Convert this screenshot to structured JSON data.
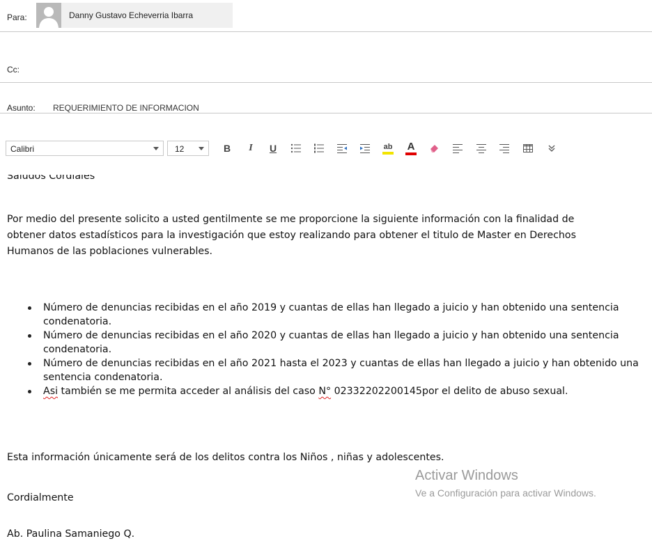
{
  "header": {
    "to_label": "Para:",
    "to_recipient": "Danny Gustavo Echeverria Ibarra",
    "cc_label": "Cc:",
    "subject_label": "Asunto:",
    "subject_value": "REQUERIMIENTO DE INFORMACION"
  },
  "toolbar": {
    "font_value": "Calibri",
    "size_value": "12",
    "bold": "B",
    "italic": "I",
    "underline": "U",
    "font_color_letter": "A",
    "highlight_label": "ab",
    "font_color": "#e00000",
    "highlight_color": "#f2e400"
  },
  "body": {
    "greeting": "Saludos Cordiales",
    "para1_line1": "Por medio del presente solicito a usted gentilmente se me proporcione la siguiente información con la finalidad de",
    "para1_line2": "obtener datos estadísticos para la investigación que estoy realizando para obtener el titulo de Master en Derechos",
    "para1_line3": "Humanos de las poblaciones vulnerables.",
    "bullet1": "Número de denuncias recibidas en el año 2019 y cuantas de ellas han llegado a juicio y han obtenido una sentencia condenatoria.",
    "bullet2": "Número de denuncias recibidas en el año 2020 y cuantas de ellas han llegado a juicio y han obtenido una sentencia condenatoria.",
    "bullet3": "Número de denuncias recibidas en el año 2021 hasta el 2023 y cuantas de ellas han llegado a juicio y han obtenido una sentencia condenatoria.",
    "bullet4_word1": "Asi",
    "bullet4_mid": " también se me permita acceder al análisis del caso ",
    "bullet4_word2": "N°",
    "bullet4_end": " 02332202200145por el delito de abuso sexual.",
    "para2": "Esta información únicamente será de los delitos contra los Niños , niñas y adolescentes.",
    "closing": "Cordialmente",
    "signature": "Ab. Paulina Samaniego Q."
  },
  "watermark": {
    "title": "Activar Windows",
    "subtitle": "Ve a Configuración para activar Windows."
  }
}
